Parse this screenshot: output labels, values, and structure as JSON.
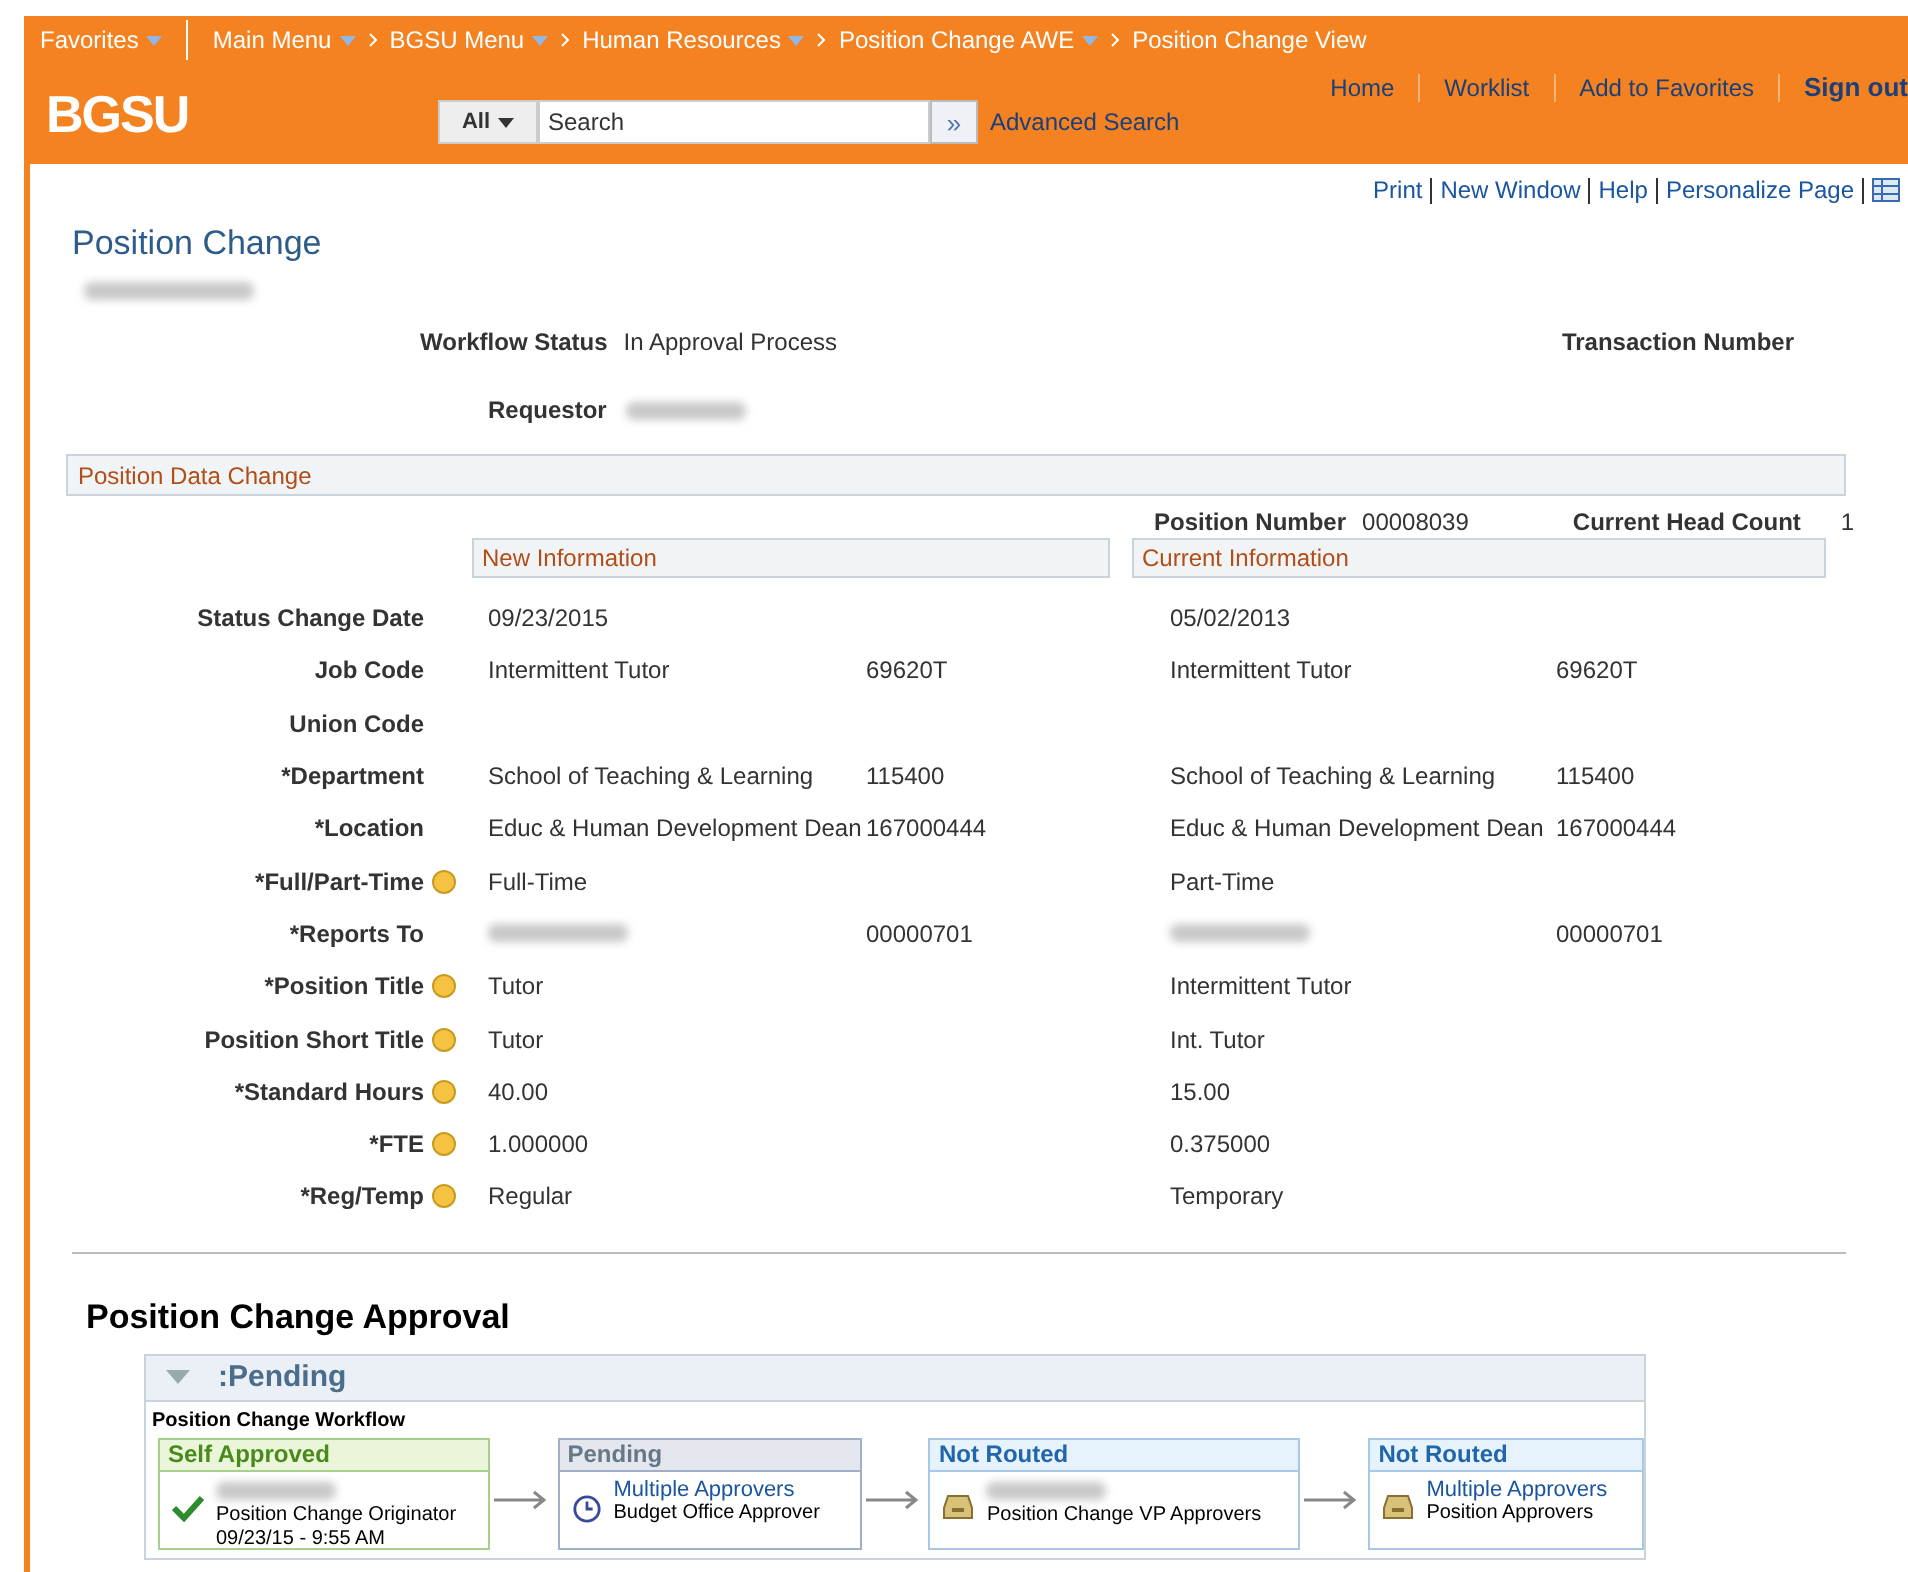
{
  "nav": {
    "breadcrumbs": [
      {
        "label": "Favorites",
        "menu": true
      },
      {
        "label": "Main Menu",
        "menu": true
      },
      {
        "label": "BGSU Menu",
        "menu": true
      },
      {
        "label": "Human Resources",
        "menu": true
      },
      {
        "label": "Position Change AWE",
        "menu": true
      },
      {
        "label": "Position Change View",
        "menu": false
      }
    ],
    "logo": "BGSU",
    "search": {
      "scope": "All",
      "placeholder": "Search",
      "go": "»",
      "advanced": "Advanced Search"
    },
    "links": [
      {
        "label": "Home",
        "bold": false
      },
      {
        "label": "Worklist",
        "bold": false
      },
      {
        "label": "Add to Favorites",
        "bold": false
      },
      {
        "label": "Sign out",
        "bold": true
      }
    ]
  },
  "page_links": [
    "Print",
    "New Window",
    "Help",
    "Personalize Page"
  ],
  "title": "Position Change",
  "header_fields": {
    "workflow_status_label": "Workflow Status",
    "workflow_status": "In Approval Process",
    "transaction_label": "Transaction Number",
    "requestor_label": "Requestor"
  },
  "section": "Position Data Change",
  "position": {
    "number_label": "Position Number",
    "number": "00008039",
    "headcount_label": "Current Head Count",
    "headcount": "1"
  },
  "new_header": "New Information",
  "current_header": "Current Information",
  "rows": [
    {
      "label": "Status Change Date",
      "changed": false,
      "new": "09/23/2015",
      "current": "05/02/2013",
      "redacted": false
    },
    {
      "label": "Job Code",
      "changed": false,
      "new": "Intermittent Tutor",
      "new_code": "69620T",
      "current": "Intermittent Tutor",
      "current_code": "69620T",
      "redacted": false
    },
    {
      "label": "Union Code",
      "changed": false,
      "redacted": false
    },
    {
      "label": "*Department",
      "changed": false,
      "new": "School of Teaching & Learning",
      "new_code": "115400",
      "current": "School of Teaching & Learning",
      "current_code": "115400",
      "redacted": false
    },
    {
      "label": "*Location",
      "changed": false,
      "new": "Educ & Human Development Dean",
      "new_code": "167000444",
      "current": "Educ & Human Development Dean",
      "current_code": "167000444",
      "redacted": false
    },
    {
      "label": "*Full/Part-Time",
      "changed": true,
      "new": "Full-Time",
      "current": "Part-Time",
      "redacted": false
    },
    {
      "label": "*Reports To",
      "changed": false,
      "new_code": "00000701",
      "current_code": "00000701",
      "redacted": true
    },
    {
      "label": "*Position Title",
      "changed": true,
      "new": "Tutor",
      "current": "Intermittent Tutor",
      "redacted": false
    },
    {
      "label": "Position Short Title",
      "changed": true,
      "new": "Tutor",
      "current": "Int. Tutor",
      "redacted": false
    },
    {
      "label": "*Standard Hours",
      "changed": true,
      "new": "40.00",
      "current": "15.00",
      "redacted": false
    },
    {
      "label": "*FTE",
      "changed": true,
      "new": "1.000000",
      "current": "0.375000",
      "redacted": false
    },
    {
      "label": "*Reg/Temp",
      "changed": true,
      "new": "Regular",
      "current": "Temporary",
      "redacted": false
    }
  ],
  "approval": {
    "title": "Position Change Approval",
    "status": ":Pending",
    "expanded": true,
    "workflow_title": "Position Change Workflow",
    "steps": [
      {
        "status": "Self Approved",
        "kind": "approved",
        "role": "Position Change Originator",
        "date": "09/23/15 - 9:55 AM"
      },
      {
        "status": "Pending",
        "kind": "pending",
        "approver": "Multiple Approvers",
        "role": "Budget Office Approver"
      },
      {
        "status": "Not Routed",
        "kind": "not_routed",
        "role": "Position Change VP Approvers"
      },
      {
        "status": "Not Routed",
        "kind": "not_routed",
        "approver": "Multiple Approvers",
        "role": "Position Approvers"
      }
    ]
  }
}
